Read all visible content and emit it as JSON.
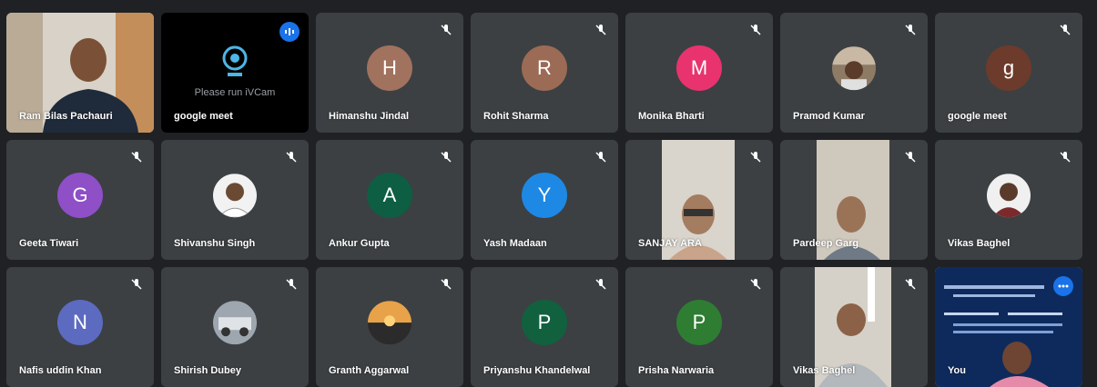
{
  "participants": [
    {
      "name": "Ram Bilas Pachauri",
      "kind": "video"
    },
    {
      "name": "google meet",
      "kind": "camera-placeholder",
      "message": "Please run iVCam",
      "speaking": true
    },
    {
      "name": "Himanshu Jindal",
      "kind": "initial",
      "initial": "H",
      "color": "#a1725e"
    },
    {
      "name": "Rohit Sharma",
      "kind": "initial",
      "initial": "R",
      "color": "#9c6b55"
    },
    {
      "name": "Monika Bharti",
      "kind": "initial",
      "initial": "M",
      "color": "#e8336e"
    },
    {
      "name": "Pramod Kumar",
      "kind": "photo"
    },
    {
      "name": "google meet",
      "kind": "initial",
      "initial": "g",
      "color": "#6d3b2b"
    },
    {
      "name": "Geeta Tiwari",
      "kind": "initial",
      "initial": "G",
      "color": "#8e4fc7"
    },
    {
      "name": "Shivanshu Singh",
      "kind": "photo"
    },
    {
      "name": "Ankur Gupta",
      "kind": "initial",
      "initial": "A",
      "color": "#0d5e43"
    },
    {
      "name": "Yash Madaan",
      "kind": "initial",
      "initial": "Y",
      "color": "#1e88e5"
    },
    {
      "name": "SANJAY ARA",
      "kind": "video"
    },
    {
      "name": "Pardeep Garg",
      "kind": "video"
    },
    {
      "name": "Vikas Baghel",
      "kind": "photo"
    },
    {
      "name": "Nafis uddin Khan",
      "kind": "initial",
      "initial": "N",
      "color": "#5c6bc0"
    },
    {
      "name": "Shirish Dubey",
      "kind": "photo"
    },
    {
      "name": "Granth Aggarwal",
      "kind": "photo"
    },
    {
      "name": "Priyanshu Khandelwal",
      "kind": "initial",
      "initial": "P",
      "color": "#11613f"
    },
    {
      "name": "Prisha Narwaria",
      "kind": "initial",
      "initial": "P",
      "color": "#2e7d32"
    },
    {
      "name": "Vikas Baghel",
      "kind": "video"
    },
    {
      "name": "You",
      "kind": "screen-share",
      "speaking": true
    }
  ]
}
